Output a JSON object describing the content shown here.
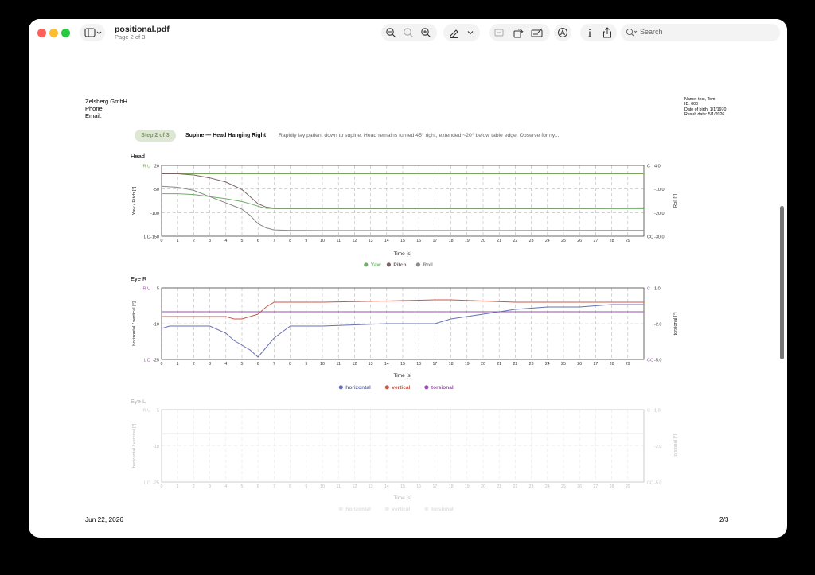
{
  "window": {
    "title": "positional.pdf",
    "subtitle": "Page 2 of 3",
    "search_placeholder": "Search",
    "icons": [
      "sidebar-icon",
      "chevron-down-icon",
      "zoom-out-icon",
      "zoom-actual-icon",
      "zoom-in-icon",
      "markup-pen-icon",
      "chevron-down-icon",
      "crop-icon",
      "rotate-icon",
      "form-icon",
      "annotate-icon",
      "info-icon",
      "share-icon",
      "search-icon"
    ]
  },
  "header": {
    "company": "Zelsberg GmbH",
    "phone_label": "Phone:",
    "email_label": "Email:",
    "patient": {
      "name": "Name: test, Tom",
      "id": "ID: 000",
      "dob": "Date of birth: 1/1/1970",
      "result_date": "Result date: 5/1/2026"
    }
  },
  "step": {
    "badge": "Step 2 of 3",
    "title": "Supine — Head Hanging Right",
    "description": "Rapidly lay patient down to supine. Head remains turned 45° right, extended ~20° below table edge. Observe for ny..."
  },
  "footer": {
    "date": "Jun 22, 2026",
    "page": "2/3"
  },
  "colors": {
    "accent_green": "#7aa35e",
    "yaw": "#6fae68",
    "pitch": "#7a6262",
    "roll": "#8a8a8a",
    "horizontal": "#6670b2",
    "vertical": "#c85a48",
    "torsional": "#9c4fb0",
    "faded": "#c8c8c8"
  },
  "chart_data": [
    {
      "type": "line",
      "title": "Head",
      "xlabel": "Time [s]",
      "ylabel_left": "Yaw / Pitch [°]",
      "ylabel_right": "Roll [°]",
      "left_top_label": "R U",
      "left_bottom_label": "L D",
      "right_top_label": "C",
      "right_bottom_label": "CC",
      "xlim": [
        0,
        30
      ],
      "ylim_left": [
        -150,
        20
      ],
      "ylim_right": [
        -30,
        4
      ],
      "yticks_left": [
        "20",
        "-50",
        "-100",
        "-150"
      ],
      "yticks_right": [
        "4.0",
        "-10.0",
        "-20.0",
        "-30.0"
      ],
      "x": [
        0,
        1,
        2,
        3,
        4,
        5,
        5.5,
        6,
        6.5,
        7,
        8,
        10,
        15,
        20,
        25,
        30
      ],
      "series": [
        {
          "name": "Yaw",
          "axis": "left",
          "values": [
            -48,
            -48,
            -50,
            -55,
            -60,
            -67,
            -72,
            -78,
            -83,
            -84,
            -84,
            -84,
            -84,
            -84,
            -84,
            -84
          ]
        },
        {
          "name": "Pitch",
          "axis": "left",
          "values": [
            0,
            0,
            -3,
            -10,
            -20,
            -38,
            -55,
            -72,
            -80,
            -83,
            -83,
            -83,
            -83,
            -83,
            -83,
            -82
          ]
        },
        {
          "name": "Roll",
          "axis": "right",
          "values": [
            -6,
            -6.5,
            -8,
            -11,
            -14,
            -17,
            -20,
            -24,
            -26,
            -27,
            -27.2,
            -27.3,
            -27.3,
            -27.3,
            -27.2,
            -27.2
          ]
        }
      ],
      "reference_line": {
        "axis": "left",
        "value": 0
      }
    },
    {
      "type": "line",
      "title": "Eye R",
      "xlabel": "Time [s]",
      "ylabel_left": "horizontal / vertical [°]",
      "ylabel_right": "torsional [°]",
      "left_top_label": "R U",
      "left_bottom_label": "L D",
      "right_top_label": "C",
      "right_bottom_label": "CC",
      "xlim": [
        0,
        30
      ],
      "ylim_left": [
        -25,
        5
      ],
      "ylim_right": [
        -5,
        1
      ],
      "yticks_left": [
        "5",
        "-10",
        "-25"
      ],
      "yticks_right": [
        "1.0",
        "-2.0",
        "-5.0"
      ],
      "x": [
        0,
        0.5,
        1,
        2,
        3,
        4,
        4.5,
        5,
        5.5,
        6,
        6.5,
        7,
        8,
        10,
        14,
        17,
        18,
        20,
        22,
        24,
        26,
        28,
        29,
        30
      ],
      "series": [
        {
          "name": "horizontal",
          "axis": "left",
          "values": [
            -12,
            -11,
            -11,
            -11,
            -11,
            -14,
            -17,
            -19,
            -21,
            -24,
            -20,
            -16,
            -11,
            -11,
            -10,
            -10,
            -8,
            -6,
            -4,
            -3,
            -3,
            -2,
            -2,
            -2
          ]
        },
        {
          "name": "vertical",
          "axis": "left",
          "values": [
            -7,
            -7,
            -7,
            -7,
            -7,
            -7,
            -8,
            -8,
            -7,
            -6,
            -3,
            -1,
            -1,
            -1,
            -0.5,
            0,
            0,
            -0.5,
            -1,
            -1,
            -1,
            -1,
            -1,
            -1
          ]
        },
        {
          "name": "torsional",
          "axis": "right",
          "values": [
            -1,
            -1,
            -1,
            -1,
            -1,
            -1,
            -1,
            -1,
            -1,
            -1,
            -1,
            -1,
            -1,
            -1,
            -1,
            -1,
            -1,
            -1,
            -1,
            -1,
            -1,
            -1,
            -1,
            -1
          ]
        }
      ]
    },
    {
      "type": "line",
      "title": "Eye L",
      "xlabel": "Time [s]",
      "ylabel_left": "horizontal / vertical [°]",
      "ylabel_right": "torsional [°]",
      "left_top_label": "R U",
      "left_bottom_label": "L D",
      "right_top_label": "C",
      "right_bottom_label": "CC",
      "xlim": [
        0,
        30
      ],
      "ylim_left": [
        -25,
        5
      ],
      "ylim_right": [
        -5,
        1
      ],
      "yticks_left": [
        "5",
        "-10",
        "-25"
      ],
      "yticks_right": [
        "1.0",
        "-2.0",
        "-5.0"
      ],
      "x": [
        0,
        30
      ],
      "series": [
        {
          "name": "horizontal",
          "axis": "left",
          "values": []
        },
        {
          "name": "vertical",
          "axis": "left",
          "values": []
        },
        {
          "name": "torsional",
          "axis": "right",
          "values": [
            -1,
            -1
          ]
        }
      ],
      "faded": true
    }
  ]
}
